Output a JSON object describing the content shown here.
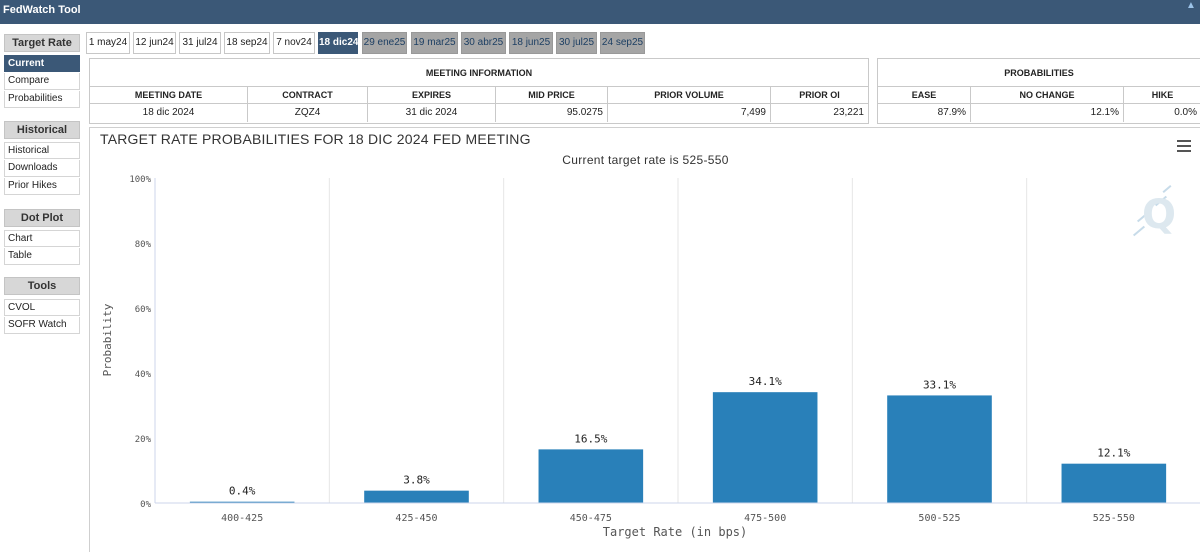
{
  "app": {
    "title": "FedWatch Tool"
  },
  "sidebar": {
    "sections": [
      {
        "heading": "Target Rate",
        "items": [
          "Current",
          "Compare",
          "Probabilities"
        ]
      },
      {
        "heading": "Historical",
        "items": [
          "Historical",
          "Downloads",
          "Prior Hikes"
        ]
      },
      {
        "heading": "Dot Plot",
        "items": [
          "Chart",
          "Table"
        ]
      },
      {
        "heading": "Tools",
        "items": [
          "CVOL",
          "SOFR Watch"
        ]
      }
    ],
    "active_item": "Current"
  },
  "tabs": [
    {
      "label": "1 may24",
      "state": "past"
    },
    {
      "label": "12 jun24",
      "state": "past"
    },
    {
      "label": "31 jul24",
      "state": "past"
    },
    {
      "label": "18 sep24",
      "state": "past"
    },
    {
      "label": "7 nov24",
      "state": "past"
    },
    {
      "label": "18 dic24",
      "state": "active"
    },
    {
      "label": "29 ene25",
      "state": "future"
    },
    {
      "label": "19 mar25",
      "state": "future"
    },
    {
      "label": "30 abr25",
      "state": "future"
    },
    {
      "label": "18 jun25",
      "state": "future"
    },
    {
      "label": "30 jul25",
      "state": "future"
    },
    {
      "label": "24 sep25",
      "state": "future"
    }
  ],
  "meeting_info": {
    "title": "MEETING INFORMATION",
    "headers": [
      "MEETING DATE",
      "CONTRACT",
      "EXPIRES",
      "MID PRICE",
      "PRIOR VOLUME",
      "PRIOR OI"
    ],
    "values": [
      "18 dic 2024",
      "ZQZ4",
      "31 dic 2024",
      "95.0275",
      "7,499",
      "23,221"
    ]
  },
  "probabilities": {
    "title": "PROBABILITIES",
    "headers": [
      "EASE",
      "NO CHANGE",
      "HIKE"
    ],
    "values": [
      "87.9%",
      "12.1%",
      "0.0%"
    ]
  },
  "chart_data": {
    "type": "bar",
    "title": "TARGET RATE PROBABILITIES FOR 18 DIC 2024 FED MEETING",
    "subtitle": "Current target rate is 525-550",
    "xlabel": "Target Rate (in bps)",
    "ylabel": "Probability",
    "categories": [
      "400-425",
      "425-450",
      "450-475",
      "475-500",
      "500-525",
      "525-550"
    ],
    "values": [
      0.4,
      3.8,
      16.5,
      34.1,
      33.1,
      12.1
    ],
    "data_labels": [
      "0.4%",
      "3.8%",
      "16.5%",
      "34.1%",
      "33.1%",
      "12.1%"
    ],
    "ylim": [
      0,
      100
    ],
    "yticks": [
      "0%",
      "20%",
      "40%",
      "60%",
      "80%",
      "100%"
    ],
    "grid": "vertical",
    "bar_color": "#2980b9",
    "legend": "none"
  },
  "colors": {
    "header": "#3b5877",
    "tab_future": "#a5a5a5",
    "bar": "#2980b9"
  },
  "icons": {
    "menu": "hamburger-menu-icon",
    "logo": "quikstrike-logo-icon",
    "corner": "twitter-bird-icon"
  }
}
